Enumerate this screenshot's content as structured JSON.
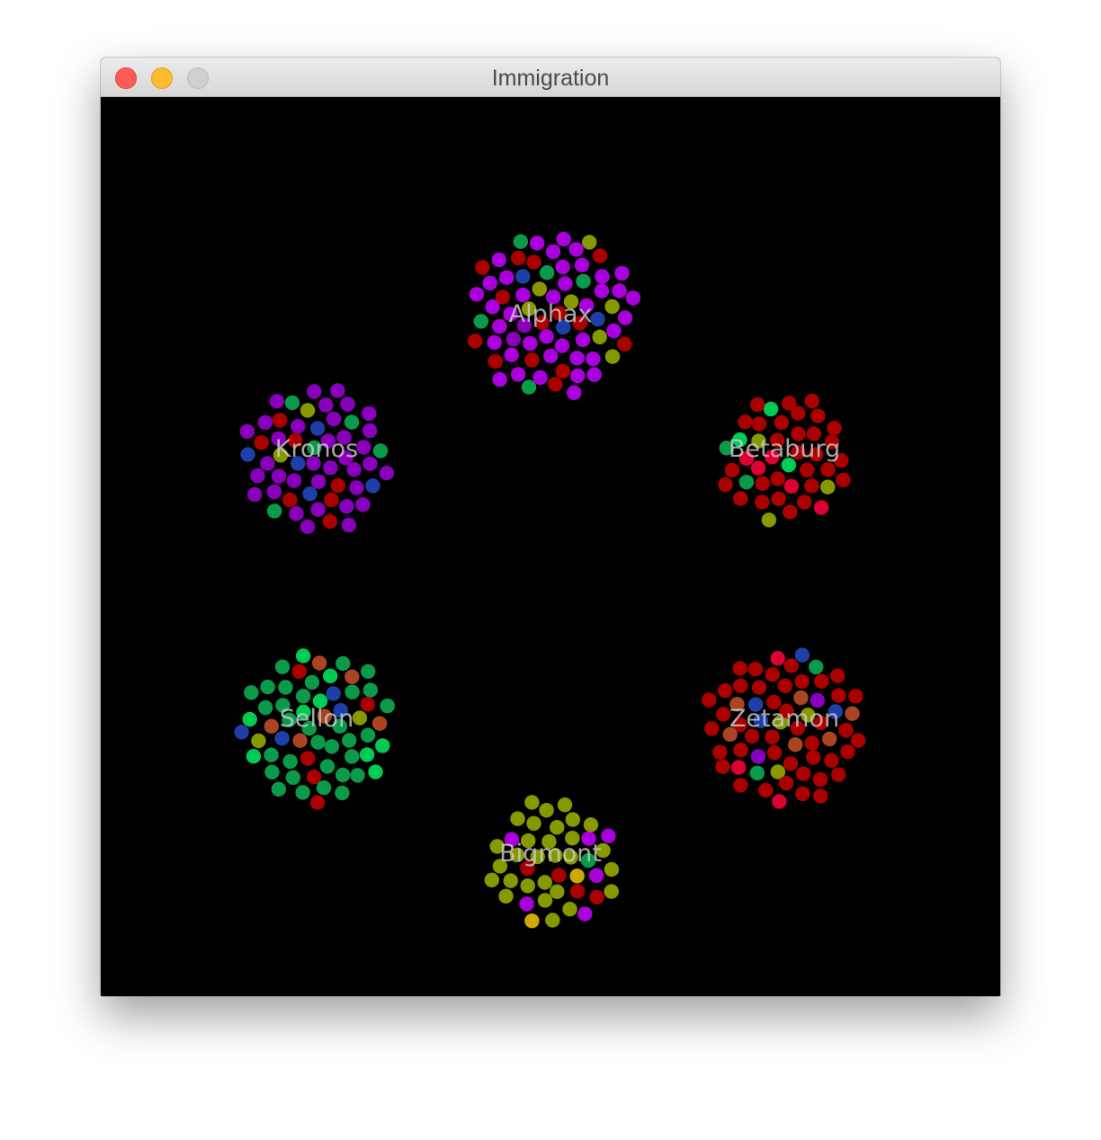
{
  "window": {
    "title": "Immigration"
  },
  "colors": {
    "background": "#000000",
    "label": "#cccccc",
    "palette": [
      "#8800bb",
      "#889900",
      "#0a9a4a",
      "#aa0000",
      "#1f3fa8",
      "#aa00dd",
      "#00cc55",
      "#dd0033",
      "#aa4422"
    ]
  },
  "cities": [
    {
      "name": "Alphax",
      "dominant_color": "#aa00dd",
      "palette": [
        "#8800bb",
        "#aa00dd",
        "#889900",
        "#0a9a4a",
        "#aa0000",
        "#1f3fa8"
      ]
    },
    {
      "name": "Betaburg",
      "dominant_color": "#aa0000",
      "palette": [
        "#aa0000",
        "#0a9a4a",
        "#889900",
        "#dd0033",
        "#00cc55"
      ]
    },
    {
      "name": "Kronos",
      "dominant_color": "#8800bb",
      "palette": [
        "#8800bb",
        "#1f3fa8",
        "#0a9a4a",
        "#889900",
        "#aa0000"
      ]
    },
    {
      "name": "Sellon",
      "dominant_color": "#0a9a4a",
      "palette": [
        "#0a9a4a",
        "#aa0000",
        "#1f3fa8",
        "#00cc55",
        "#aa4422",
        "#889900"
      ]
    },
    {
      "name": "Zetamon",
      "dominant_color": "#aa0000",
      "palette": [
        "#aa0000",
        "#0a9a4a",
        "#8800bb",
        "#889900",
        "#1f3fa8",
        "#dd0033",
        "#aa4422"
      ]
    },
    {
      "name": "Bigmont",
      "dominant_color": "#889900",
      "palette": [
        "#889900",
        "#aa0000",
        "#0a9a4a",
        "#aa00dd",
        "#ccaa00"
      ]
    }
  ]
}
